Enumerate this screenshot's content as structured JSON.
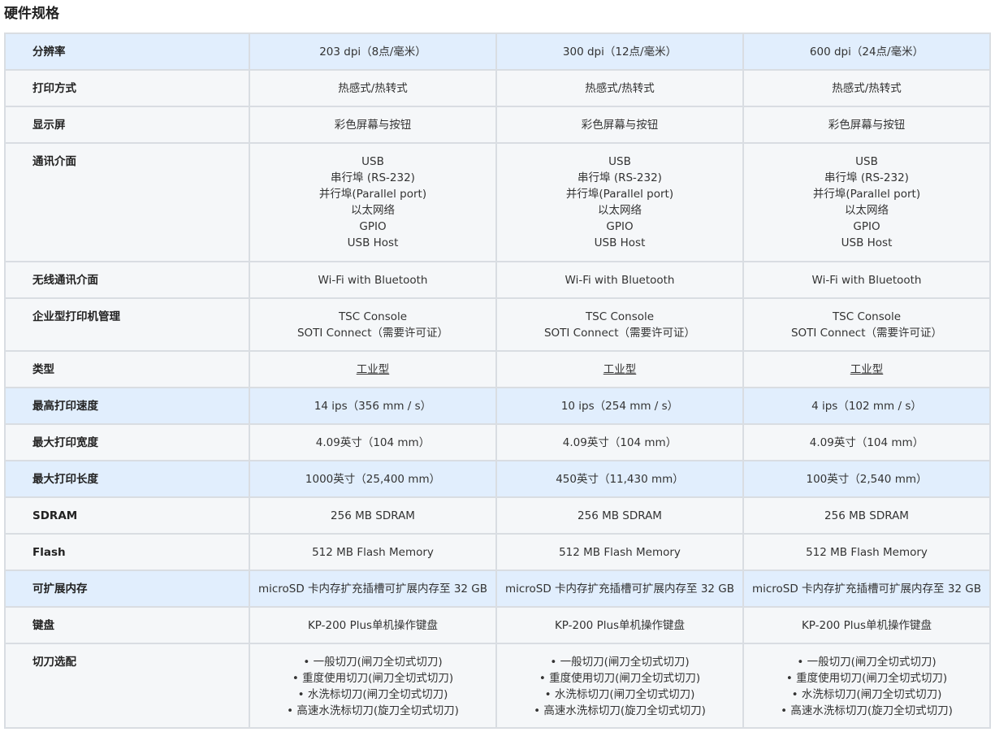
{
  "page": {
    "title": "硬件规格"
  },
  "spec_rows": [
    {
      "label": "分辨率",
      "values": [
        [
          "203 dpi（8点/毫米）"
        ],
        [
          "300 dpi（12点/毫米）"
        ],
        [
          "600 dpi（24点/毫米）"
        ]
      ]
    },
    {
      "label": "打印方式",
      "values": [
        [
          "热感式/热转式"
        ],
        [
          "热感式/热转式"
        ],
        [
          "热感式/热转式"
        ]
      ]
    },
    {
      "label": "显示屏",
      "values": [
        [
          "彩色屏幕与按钮"
        ],
        [
          "彩色屏幕与按钮"
        ],
        [
          "彩色屏幕与按钮"
        ]
      ]
    },
    {
      "label": "通讯介面",
      "values": [
        [
          "USB",
          "串行埠 (RS-232)",
          "并行埠(Parallel port)",
          "以太网络",
          "GPIO",
          "USB Host"
        ],
        [
          "USB",
          "串行埠 (RS-232)",
          "并行埠(Parallel port)",
          "以太网络",
          "GPIO",
          "USB Host"
        ],
        [
          "USB",
          "串行埠 (RS-232)",
          "并行埠(Parallel port)",
          "以太网络",
          "GPIO",
          "USB Host"
        ]
      ]
    },
    {
      "label": "无线通讯介面",
      "values": [
        [
          "Wi-Fi with Bluetooth"
        ],
        [
          "Wi-Fi with Bluetooth"
        ],
        [
          "Wi-Fi with Bluetooth"
        ]
      ]
    },
    {
      "label": "企业型打印机管理",
      "values": [
        [
          "TSC Console",
          "SOTI Connect（需要许可证）"
        ],
        [
          "TSC Console",
          "SOTI Connect（需要许可证）"
        ],
        [
          "TSC Console",
          "SOTI Connect（需要许可证）"
        ]
      ]
    },
    {
      "label": "类型",
      "values": [
        [
          "工业型"
        ],
        [
          "工业型"
        ],
        [
          "工业型"
        ]
      ]
    },
    {
      "label": "最高打印速度",
      "values": [
        [
          "14 ips（356 mm / s）"
        ],
        [
          "10 ips（254 mm / s）"
        ],
        [
          "4 ips（102 mm / s）"
        ]
      ]
    },
    {
      "label": "最大打印宽度",
      "values": [
        [
          "4.09英寸（104 mm）"
        ],
        [
          "4.09英寸（104 mm）"
        ],
        [
          "4.09英寸（104 mm）"
        ]
      ]
    },
    {
      "label": "最大打印长度",
      "values": [
        [
          "1000英寸（25,400 mm）"
        ],
        [
          "450英寸（11,430 mm）"
        ],
        [
          "100英寸（2,540 mm）"
        ]
      ]
    },
    {
      "label": "SDRAM",
      "values": [
        [
          "256 MB SDRAM"
        ],
        [
          "256 MB SDRAM"
        ],
        [
          "256 MB SDRAM"
        ]
      ]
    },
    {
      "label": "Flash",
      "values": [
        [
          "512 MB Flash Memory"
        ],
        [
          "512 MB Flash Memory"
        ],
        [
          "512 MB Flash Memory"
        ]
      ]
    },
    {
      "label": "可扩展内存",
      "values": [
        [
          "microSD 卡内存扩充插槽可扩展内存至 32 GB"
        ],
        [
          "microSD 卡内存扩充插槽可扩展内存至 32 GB"
        ],
        [
          "microSD 卡内存扩充插槽可扩展内存至 32 GB"
        ]
      ]
    },
    {
      "label": "键盘",
      "values": [
        [
          "KP-200 Plus单机操作键盘"
        ],
        [
          "KP-200 Plus单机操作键盘"
        ],
        [
          "KP-200 Plus单机操作键盘"
        ]
      ]
    },
    {
      "label": "切刀选配",
      "values": [
        [
          "• 一般切刀(闸刀全切式切刀)",
          "• 重度使用切刀(闸刀全切式切刀)",
          "• 水洗标切刀(闸刀全切式切刀)",
          "• 高速水洗标切刀(旋刀全切式切刀)"
        ],
        [
          "• 一般切刀(闸刀全切式切刀)",
          "• 重度使用切刀(闸刀全切式切刀)",
          "• 水洗标切刀(闸刀全切式切刀)",
          "• 高速水洗标切刀(旋刀全切式切刀)"
        ],
        [
          "• 一般切刀(闸刀全切式切刀)",
          "• 重度使用切刀(闸刀全切式切刀)",
          "• 水洗标切刀(闸刀全切式切刀)",
          "• 高速水洗标切刀(旋刀全切式切刀)"
        ]
      ]
    }
  ],
  "colors": {
    "highlight_row_bg": "#e1eefd",
    "plain_row_bg": "#f5f7f9",
    "border": "#d9dde2"
  }
}
